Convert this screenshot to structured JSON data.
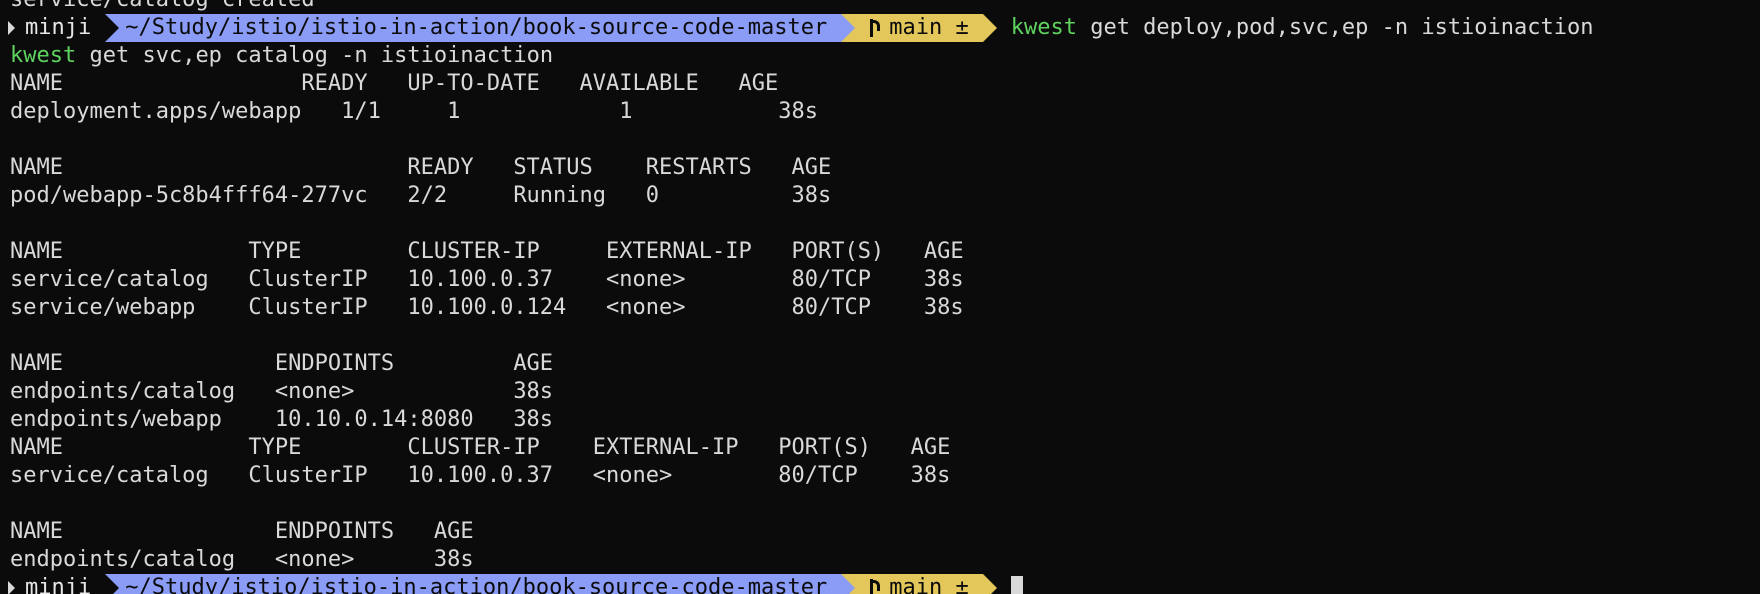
{
  "colors": {
    "background": "#0b0b0c",
    "text": "#d9d9d9",
    "command_green": "#5fd35f",
    "path_segment": "#8b9cf6",
    "git_segment": "#e4c75a"
  },
  "top_line": "service/catalog created",
  "prompt": {
    "host": "minji",
    "path": "~/Study/istio/istio-in-action/book-source-code-master",
    "branch": "main ±",
    "branch_icon": "git-branch-icon"
  },
  "first_command": {
    "keyword": "kwest",
    "args": " get deploy,pod,svc,ep -n istioinaction"
  },
  "second_command": {
    "keyword": "kwest",
    "args": " get svc,ep catalog -n istioinaction"
  },
  "output_lines": [
    "NAME                  READY   UP-TO-DATE   AVAILABLE   AGE",
    "deployment.apps/webapp   1/1     1            1           38s",
    "",
    "NAME                          READY   STATUS    RESTARTS   AGE",
    "pod/webapp-5c8b4fff64-277vc   2/2     Running   0          38s",
    "",
    "NAME              TYPE        CLUSTER-IP     EXTERNAL-IP   PORT(S)   AGE",
    "service/catalog   ClusterIP   10.100.0.37    <none>        80/TCP    38s",
    "service/webapp    ClusterIP   10.100.0.124   <none>        80/TCP    38s",
    "",
    "NAME                ENDPOINTS         AGE",
    "endpoints/catalog   <none>            38s",
    "endpoints/webapp    10.10.0.14:8080   38s",
    "NAME              TYPE        CLUSTER-IP    EXTERNAL-IP   PORT(S)   AGE",
    "service/catalog   ClusterIP   10.100.0.37   <none>        80/TCP    38s",
    "",
    "NAME                ENDPOINTS   AGE",
    "endpoints/catalog   <none>      38s"
  ]
}
